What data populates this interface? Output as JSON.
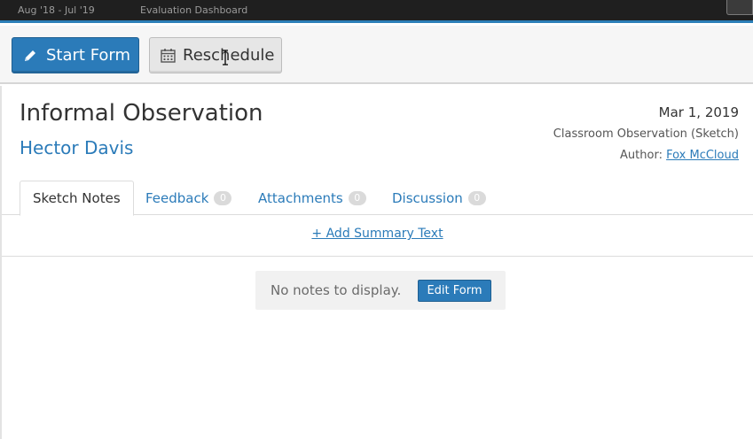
{
  "topbar": {
    "period": "Aug '18 - Jul '19",
    "section": "Evaluation Dashboard"
  },
  "toolbar": {
    "start_form_label": "Start Form",
    "start_form_icon": "pencil-icon",
    "reschedule_label": "Reschedule",
    "reschedule_icon": "calendar-icon"
  },
  "observation": {
    "title": "Informal Observation",
    "teacher": "Hector Davis",
    "date": "Mar 1, 2019",
    "type": "Classroom Observation (Sketch)",
    "author_label": "Author:",
    "author_name": "Fox McCloud"
  },
  "tabs": [
    {
      "label": "Sketch Notes",
      "active": true
    },
    {
      "label": "Feedback",
      "count": "0"
    },
    {
      "label": "Attachments",
      "count": "0"
    },
    {
      "label": "Discussion",
      "count": "0"
    }
  ],
  "summary": {
    "add_label": "+ Add Summary Text"
  },
  "notes": {
    "empty_text": "No notes to display.",
    "edit_form_label": "Edit Form"
  },
  "colors": {
    "accent": "#2b7bb9",
    "topbar": "#1f1f1f"
  }
}
